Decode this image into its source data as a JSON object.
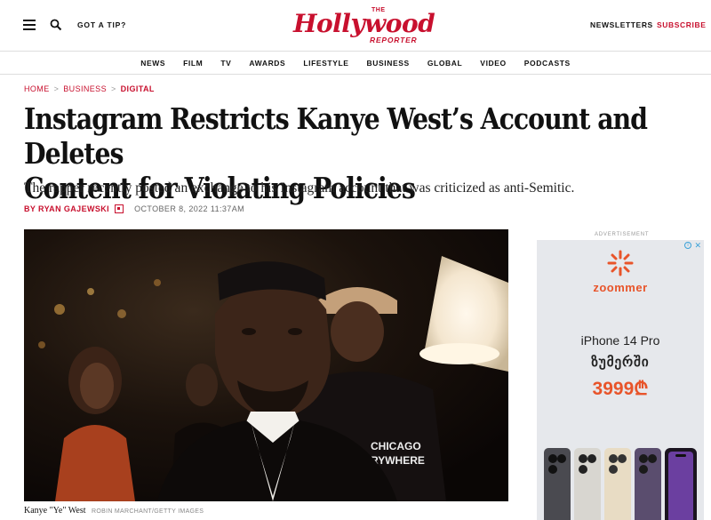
{
  "header": {
    "tip_label": "GOT A TIP?",
    "logo_the": "THE",
    "logo_main": "Hollywood",
    "logo_sub": "REPORTER",
    "newsletters_label": "NEWSLETTERS",
    "subscribe_label": "SUBSCRIBE"
  },
  "nav": {
    "items": [
      "NEWS",
      "FILM",
      "TV",
      "AWARDS",
      "LIFESTYLE",
      "BUSINESS",
      "GLOBAL",
      "VIDEO",
      "PODCASTS"
    ]
  },
  "breadcrumb": {
    "home": "HOME",
    "business": "BUSINESS",
    "digital": "DIGITAL",
    "separator": ">"
  },
  "article": {
    "headline_line1": "Instagram Restricts Kanye West’s Account and Deletes",
    "headline_line2": "Content for Violating Policies",
    "dek": "The rapper recently posted an exchange to his Instagram account that was criticized as anti-Semitic.",
    "author": "BY RYAN GAJEWSKI",
    "date": "OCTOBER 8, 2022 11:37AM",
    "caption_name": "Kanye \"Ye\" West",
    "caption_credit": "ROBIN MARCHANT/GETTY IMAGES",
    "shirt_text_1": "CHICAGO",
    "shirt_text_2": "RYWHERE"
  },
  "ad": {
    "label": "ADVERTISEMENT",
    "brand": "zoommer",
    "model": "iPhone 14 Pro",
    "geo_text": "ზუმერში",
    "price": "3999₾"
  },
  "colors": {
    "brand_red": "#c8102e",
    "ad_orange": "#e8542a",
    "ad_bg": "#e6e8ec"
  }
}
